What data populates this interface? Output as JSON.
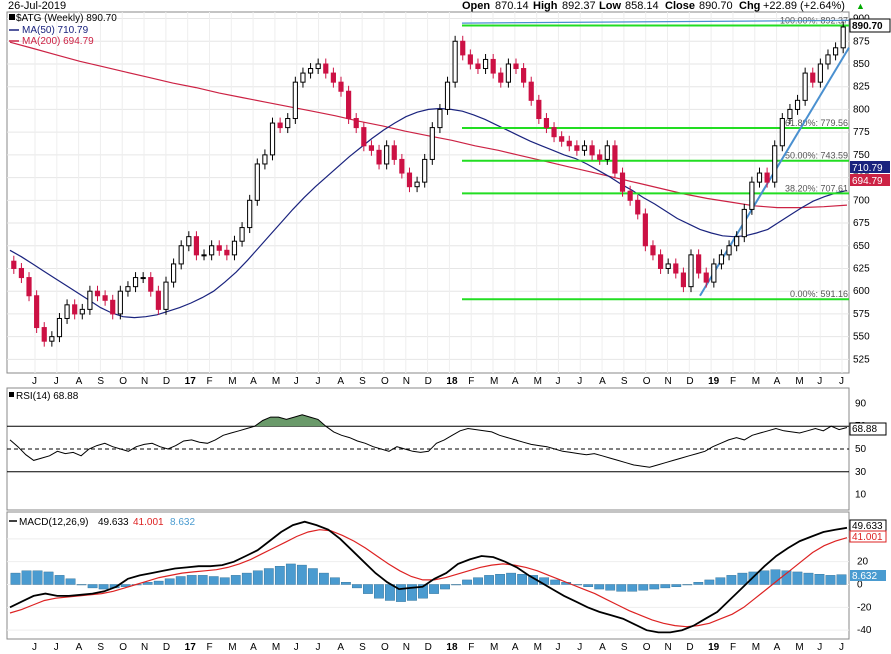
{
  "header": {
    "date": "26-Jul-2019",
    "open_label": "Open",
    "open": "870.14",
    "high_label": "High",
    "high": "892.37",
    "low_label": "Low",
    "low": "858.14",
    "close_label": "Close",
    "close": "890.70",
    "chg_label": "Chg",
    "chg": "+22.89 (+2.64%)",
    "chg_arrow": "▲"
  },
  "chart_data": {
    "type": "candlestick",
    "symbol_legend": "$ATG (Weekly) 890.70",
    "ma50_legend": "MA(50) 710.79",
    "ma200_legend": "MA(200) 694.79",
    "price_ticks": [
      "900",
      "875",
      "850",
      "825",
      "800",
      "775",
      "750",
      "725",
      "700",
      "675",
      "650",
      "625",
      "600",
      "575",
      "550",
      "525"
    ],
    "price_ylim": [
      510,
      905
    ],
    "x_months": [
      "J",
      "J",
      "A",
      "S",
      "O",
      "N",
      "D",
      "17",
      "F",
      "M",
      "A",
      "M",
      "J",
      "J",
      "A",
      "S",
      "O",
      "N",
      "D",
      "18",
      "F",
      "M",
      "A",
      "M",
      "J",
      "J",
      "A",
      "S",
      "O",
      "N",
      "D",
      "19",
      "F",
      "M",
      "A",
      "M",
      "J",
      "J"
    ],
    "bold_months": [
      "17",
      "18",
      "19"
    ],
    "price_badges": {
      "close": "890.70",
      "ma50": "710.79",
      "ma200": "694.79"
    },
    "fib_labels": [
      {
        "text": "100.00%: 892.37",
        "value": 892.37
      },
      {
        "text": "61.80%: 779.56",
        "value": 779.56
      },
      {
        "text": "50.00%: 743.59",
        "value": 743.59
      },
      {
        "text": "38.20%: 707.61",
        "value": 707.61
      },
      {
        "text": "0.00%: 591.16",
        "value": 591.16
      }
    ],
    "closes": [
      625,
      615,
      595,
      560,
      545,
      550,
      570,
      585,
      575,
      580,
      600,
      595,
      590,
      575,
      600,
      605,
      615,
      615,
      600,
      580,
      610,
      630,
      650,
      660,
      640,
      640,
      650,
      645,
      640,
      655,
      670,
      700,
      740,
      750,
      785,
      780,
      790,
      830,
      840,
      845,
      850,
      840,
      830,
      820,
      790,
      780,
      760,
      755,
      740,
      760,
      745,
      730,
      715,
      720,
      745,
      780,
      800,
      830,
      875,
      860,
      850,
      845,
      855,
      840,
      830,
      850,
      845,
      830,
      810,
      790,
      780,
      770,
      765,
      760,
      755,
      760,
      750,
      745,
      760,
      730,
      710,
      700,
      685,
      650,
      640,
      625,
      630,
      620,
      605,
      640,
      620,
      610,
      630,
      640,
      650,
      660,
      690,
      720,
      730,
      720,
      760,
      790,
      800,
      810,
      840,
      830,
      850,
      860,
      867.81,
      890.7
    ],
    "ma50": [
      645,
      638,
      630,
      622,
      614,
      606,
      598,
      590,
      582,
      576,
      572,
      571,
      572,
      574,
      578,
      582,
      587,
      593,
      600,
      610,
      621,
      634,
      648,
      662,
      676,
      690,
      703,
      715,
      726,
      737,
      748,
      758,
      768,
      777,
      785,
      792,
      797,
      800,
      801,
      800,
      798,
      794,
      789,
      783,
      777,
      771,
      765,
      760,
      755,
      750,
      746,
      740,
      733,
      726,
      718,
      711,
      703,
      696,
      688,
      680,
      674,
      668,
      664,
      661,
      660,
      661,
      664,
      668,
      676,
      684,
      692,
      699,
      704,
      708,
      710.79
    ],
    "ma200": [
      874,
      867,
      860,
      853,
      847,
      841,
      835,
      829,
      824,
      818,
      813,
      808,
      803,
      798,
      793,
      787,
      782,
      776,
      771,
      766,
      760,
      755,
      749,
      743,
      737,
      731,
      725,
      719,
      713,
      707,
      702,
      698,
      694,
      692,
      692,
      693,
      694.79
    ],
    "rsi": {
      "legend": "RSI(14) 68.88",
      "ticks": [
        "90",
        "70",
        "50",
        "30",
        "10"
      ],
      "ylim": [
        0,
        100
      ],
      "levels": [
        70,
        30
      ],
      "last_badge": "68.88",
      "values": [
        58,
        52,
        45,
        40,
        42,
        44,
        48,
        46,
        47,
        44,
        50,
        53,
        55,
        52,
        50,
        48,
        52,
        54,
        55,
        52,
        50,
        53,
        57,
        58,
        56,
        55,
        58,
        62,
        64,
        66,
        68,
        70,
        75,
        78,
        78,
        76,
        78,
        80,
        78,
        76,
        70,
        65,
        62,
        60,
        57,
        55,
        52,
        50,
        48,
        52,
        50,
        48,
        47,
        48,
        55,
        58,
        62,
        66,
        68,
        67,
        66,
        65,
        62,
        60,
        58,
        56,
        54,
        53,
        52,
        50,
        48,
        47,
        46,
        45,
        46,
        44,
        42,
        40,
        38,
        36,
        35,
        34,
        36,
        38,
        40,
        42,
        44,
        46,
        48,
        52,
        55,
        58,
        60,
        58,
        62,
        64,
        66,
        68,
        66,
        65,
        64,
        66,
        68,
        66,
        70,
        67,
        68.88
      ]
    },
    "macd": {
      "legend_name": "MACD(12,26,9)",
      "legend_macd": "49.633",
      "legend_signal": "41.001",
      "legend_hist": "8.632",
      "ticks": [
        "40",
        "20",
        "0",
        "-20",
        "-40"
      ],
      "ylim": [
        -46,
        60
      ],
      "badges": {
        "macd": "49.633",
        "signal": "41.001",
        "hist": "8.632"
      },
      "macd_values": [
        -20,
        -15,
        -10,
        -8,
        -10,
        -10,
        -9,
        -8,
        -6,
        -2,
        5,
        8,
        10,
        12,
        14,
        15,
        16,
        16,
        17,
        20,
        25,
        30,
        38,
        46,
        52,
        55,
        52,
        48,
        40,
        30,
        20,
        10,
        2,
        -4,
        -3,
        -2,
        5,
        10,
        18,
        22,
        25,
        24,
        20,
        15,
        8,
        2,
        -4,
        -10,
        -15,
        -20,
        -24,
        -27,
        -30,
        -35,
        -40,
        -42,
        -42,
        -40,
        -36,
        -30,
        -24,
        -14,
        -4,
        6,
        16,
        25,
        32,
        38,
        42,
        46,
        48,
        49.633
      ],
      "signal_values": [
        -25,
        -22,
        -18,
        -14,
        -12,
        -11,
        -10,
        -9,
        -8,
        -6,
        -3,
        0,
        3,
        6,
        8,
        10,
        11,
        12,
        13,
        15,
        18,
        22,
        27,
        32,
        37,
        42,
        46,
        48,
        47,
        43,
        38,
        32,
        25,
        18,
        12,
        7,
        4,
        4,
        6,
        9,
        12,
        15,
        17,
        18,
        17,
        15,
        12,
        8,
        4,
        0,
        -4,
        -8,
        -13,
        -18,
        -23,
        -27,
        -31,
        -34,
        -36,
        -37,
        -36,
        -34,
        -30,
        -26,
        -20,
        -12,
        -4,
        4,
        12,
        20,
        28,
        34,
        38,
        41.001
      ],
      "histogram": [
        10,
        12,
        12,
        11,
        8,
        5,
        0,
        -3,
        -4,
        -3,
        -2,
        0,
        2,
        3,
        5,
        7,
        8,
        8,
        7,
        6,
        8,
        10,
        12,
        14,
        16,
        18,
        17,
        14,
        10,
        6,
        2,
        -3,
        -8,
        -12,
        -14,
        -15,
        -14,
        -12,
        -8,
        -4,
        0,
        4,
        6,
        8,
        9,
        10,
        9,
        8,
        6,
        4,
        2,
        0,
        -2,
        -4,
        -5,
        -6,
        -6,
        -5,
        -4,
        -3,
        -2,
        0,
        2,
        4,
        6,
        8,
        10,
        11,
        12,
        13,
        12,
        11,
        10,
        9,
        8,
        8.632
      ]
    },
    "colors": {
      "up": "#000000",
      "down": "#cc1144",
      "ma50": "#1a237e",
      "ma200": "#cc2244",
      "fib": "#22dd22",
      "trend": "#4a90d0",
      "rsi_fill": "#6a9a6a",
      "hist": "#4a9bd0",
      "macd": "#000000",
      "signal": "#dd2222"
    }
  }
}
